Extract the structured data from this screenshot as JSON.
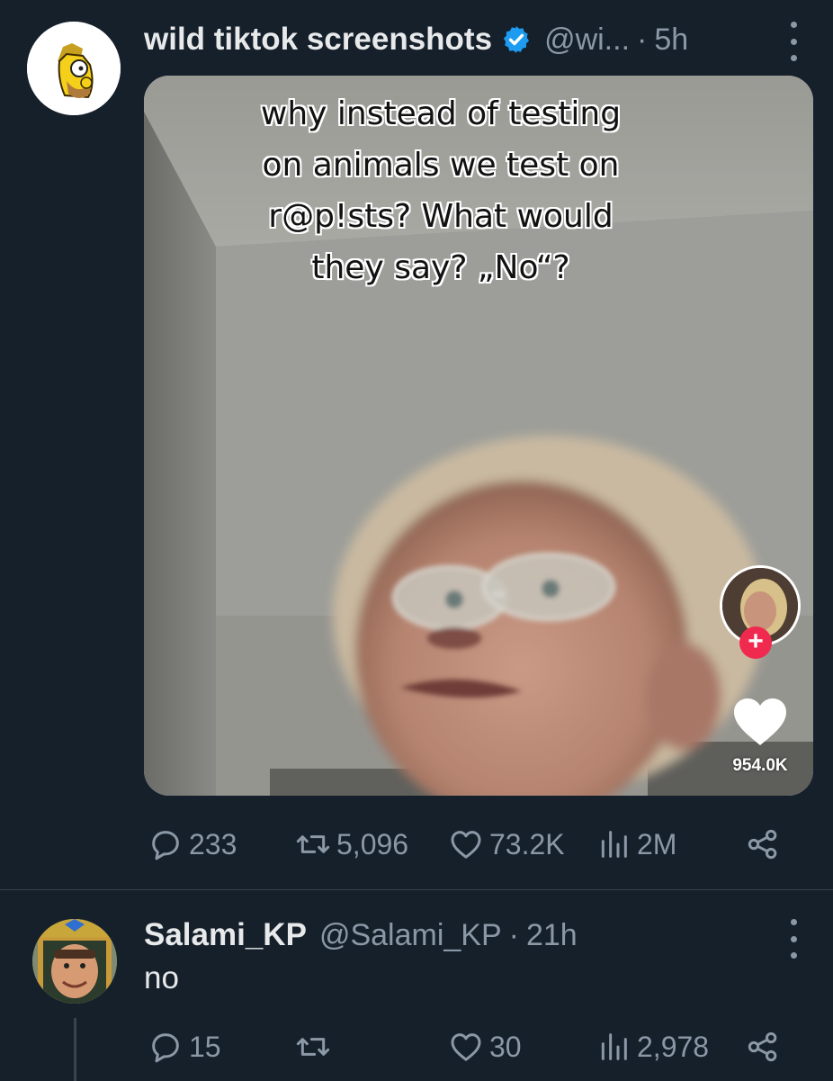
{
  "tweet1": {
    "display_name": "wild tiktok screenshots",
    "handle": "@wi...",
    "separator": "·",
    "time": "5h",
    "avatar_icon": "cartoon-character-avatar",
    "verified_icon": "verified-badge-icon",
    "media": {
      "caption_lines": [
        "why instead of testing",
        "on animals we test on",
        "r@p!sts? What would",
        "they say? „No“?"
      ],
      "follow_plus": "+",
      "like_count": "954.0K"
    },
    "actions": {
      "replies": "233",
      "retweets": "5,096",
      "likes": "73.2K",
      "views": "2M"
    }
  },
  "tweet2": {
    "display_name": "Salami_KP",
    "handle": "@Salami_KP",
    "separator": "·",
    "time": "21h",
    "text": "no",
    "avatar_icon": "game-character-avatar",
    "actions": {
      "replies": "15",
      "retweets": "",
      "likes": "30",
      "views": "2,978"
    }
  },
  "colors": {
    "background": "#15202b",
    "text_primary": "#e7e9ea",
    "text_secondary": "#8b98a5",
    "verified": "#1d9bf0",
    "divider": "#38444d",
    "tiktok_follow": "#f0294e"
  }
}
